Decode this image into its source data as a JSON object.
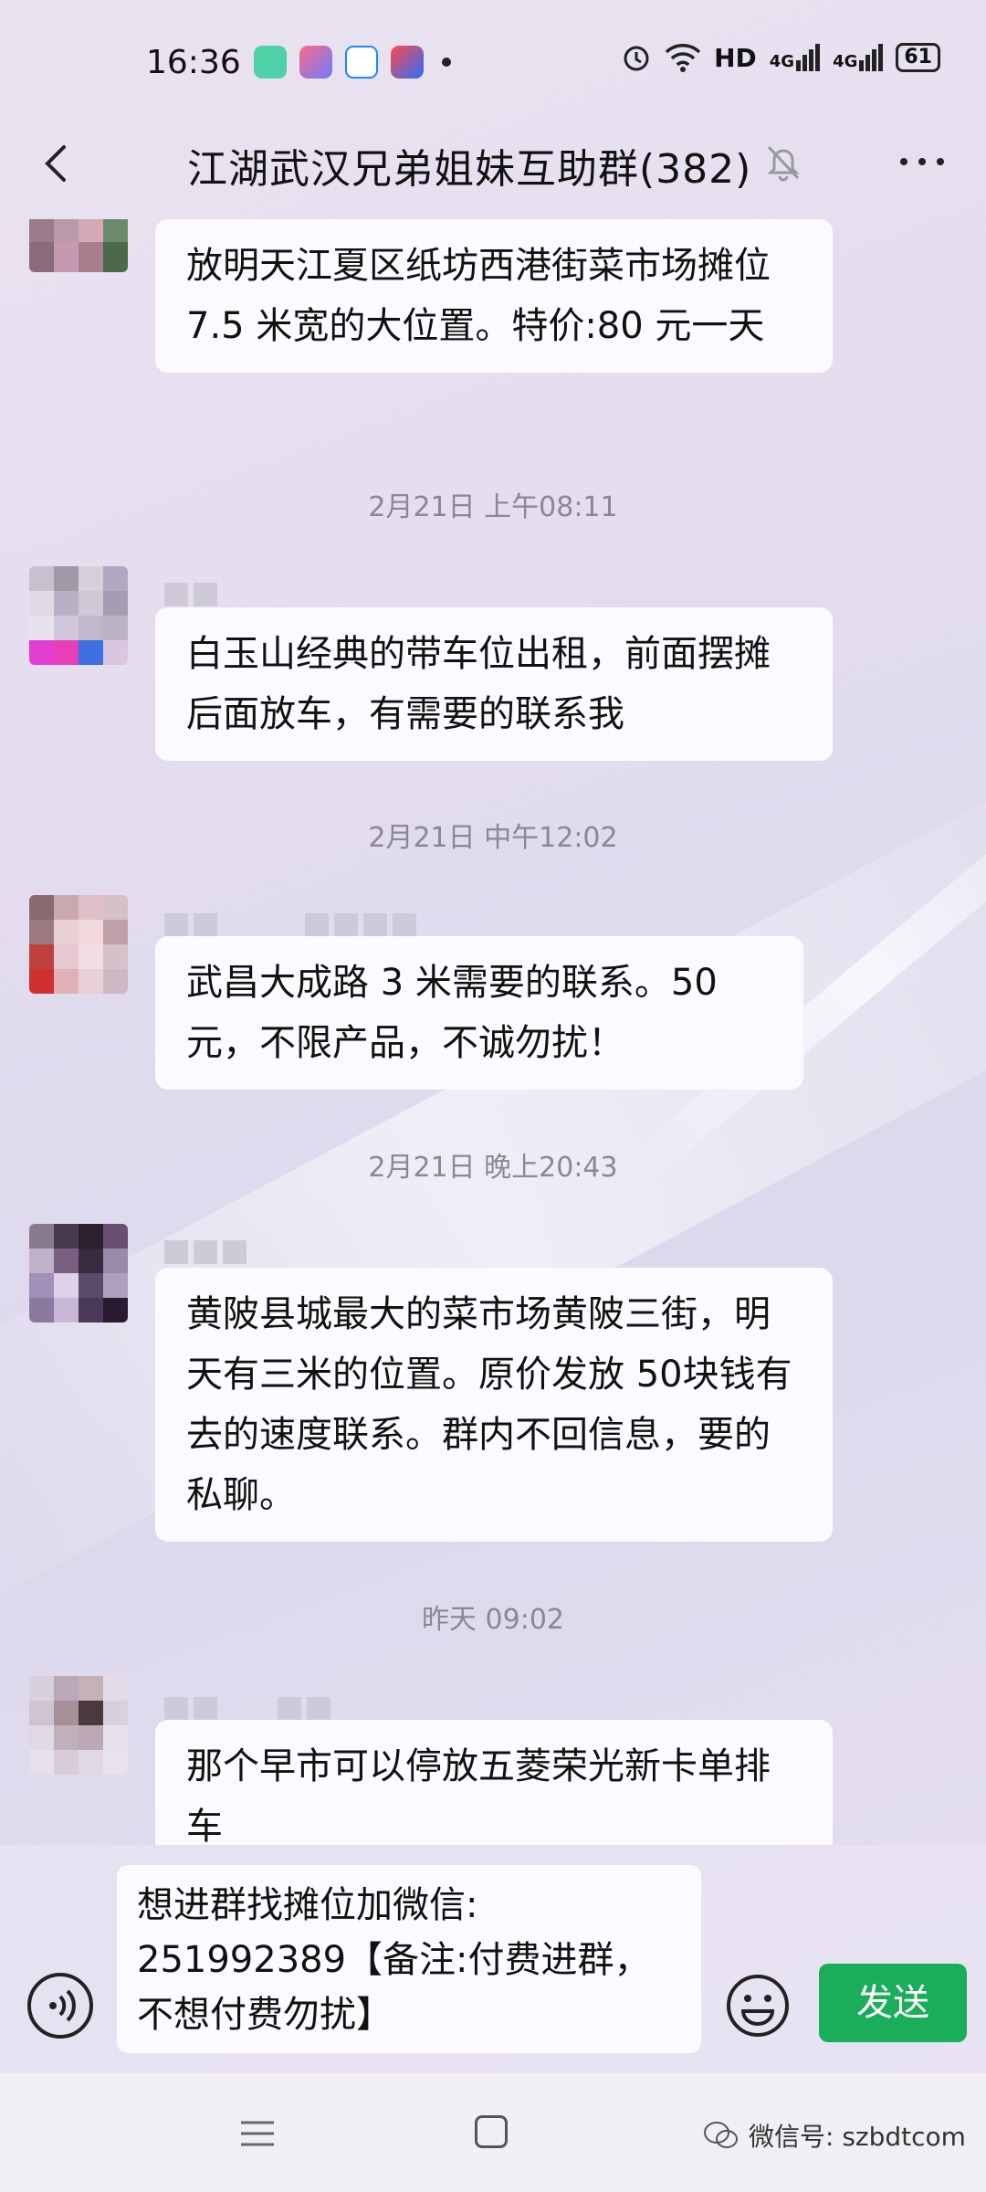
{
  "status_bar": {
    "time": "16:36",
    "network": "HD",
    "signal1": "4G",
    "signal2": "4G",
    "battery": "61"
  },
  "header": {
    "title": "江湖武汉兄弟姐妹互助群(382)"
  },
  "messages": [
    {
      "text": "放明天江夏区纸坊西港街菜市场摊位 7.5 米宽的大位置。特价:80 元一天"
    },
    {
      "timestamp": "2月21日 上午08:11",
      "text": "白玉山经典的带车位出租，前面摆摊后面放车，有需要的联系我"
    },
    {
      "timestamp": "2月21日 中午12:02",
      "text": "武昌大成路 3 米需要的联系。50元，不限产品，不诚勿扰！"
    },
    {
      "timestamp": "2月21日 晚上20:43",
      "text": "黄陂县城最大的菜市场黄陂三街，明天有三米的位置。原价发放 50块钱有去的速度联系。群内不回信息，要的私聊。"
    },
    {
      "timestamp": "昨天 09:02",
      "text": "那个早市可以停放五菱荣光新卡单排车"
    }
  ],
  "input": {
    "value": "想进群找摊位加微信: 251992389【备注:付费进群，不想付费勿扰】"
  },
  "send_label": "发送",
  "watermark": "微信号: szbdtcom",
  "colors": {
    "send": "#1aad5a",
    "bubble": "#fbfaff"
  }
}
